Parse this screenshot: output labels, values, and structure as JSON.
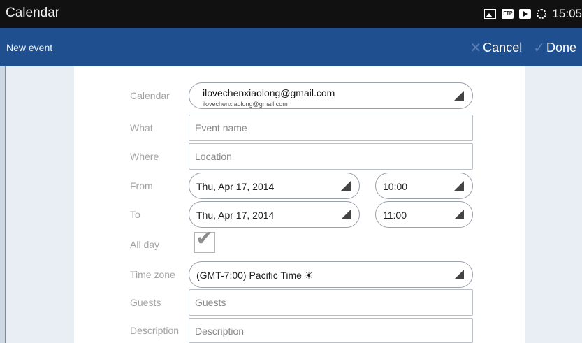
{
  "status": {
    "title": "Calendar",
    "time": "15:05",
    "icons": [
      "image-icon",
      "ftp-icon",
      "play-store-icon",
      "sync-icon"
    ]
  },
  "action_bar": {
    "title": "New event",
    "cancel_label": "Cancel",
    "done_label": "Done"
  },
  "form": {
    "calendar": {
      "label": "Calendar",
      "account": "ilovechenxiaolong@gmail.com",
      "account_sub": "ilovechenxiaolong@gmail.com"
    },
    "what": {
      "label": "What",
      "placeholder": "Event name"
    },
    "where": {
      "label": "Where",
      "placeholder": "Location"
    },
    "from": {
      "label": "From",
      "date": "Thu, Apr 17, 2014",
      "time": "10:00"
    },
    "to": {
      "label": "To",
      "date": "Thu, Apr 17, 2014",
      "time": "11:00"
    },
    "all_day": {
      "label": "All day",
      "checked": true
    },
    "time_zone": {
      "label": "Time zone",
      "value": "(GMT-7:00) Pacific Time ☀"
    },
    "guests": {
      "label": "Guests",
      "placeholder": "Guests"
    },
    "description": {
      "label": "Description",
      "placeholder": "Description"
    }
  }
}
